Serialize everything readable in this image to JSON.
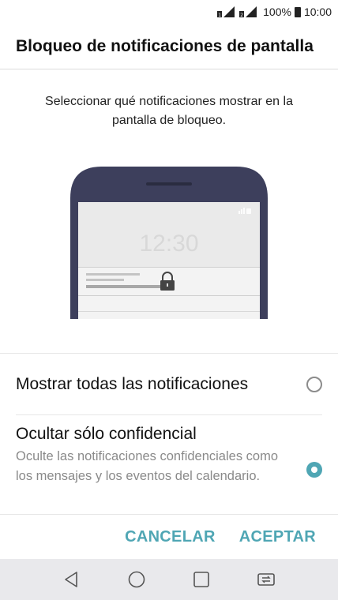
{
  "status_bar": {
    "battery": "100%",
    "time": "10:00"
  },
  "header": {
    "title": "Bloqueo de notificaciones de pantalla"
  },
  "description": "Seleccionar qué notificaciones mostrar en la pantalla de bloqueo.",
  "illustration": {
    "clock": "12:30"
  },
  "options": [
    {
      "label": "Mostrar todas las notificaciones",
      "selected": false
    },
    {
      "label": "Ocultar sólo confidencial",
      "sublabel": "Oculte las notificaciones confidenciales como los mensajes y los eventos del calendario.",
      "selected": true
    }
  ],
  "actions": {
    "cancel": "CANCELAR",
    "accept": "ACEPTAR"
  },
  "colors": {
    "accent": "#4fa6b4",
    "phone_frame": "#3d3f5c",
    "nav_bg": "#e9e9ec"
  },
  "nav_icons": [
    "back-icon",
    "home-icon",
    "recents-icon",
    "switch-screen-icon"
  ]
}
